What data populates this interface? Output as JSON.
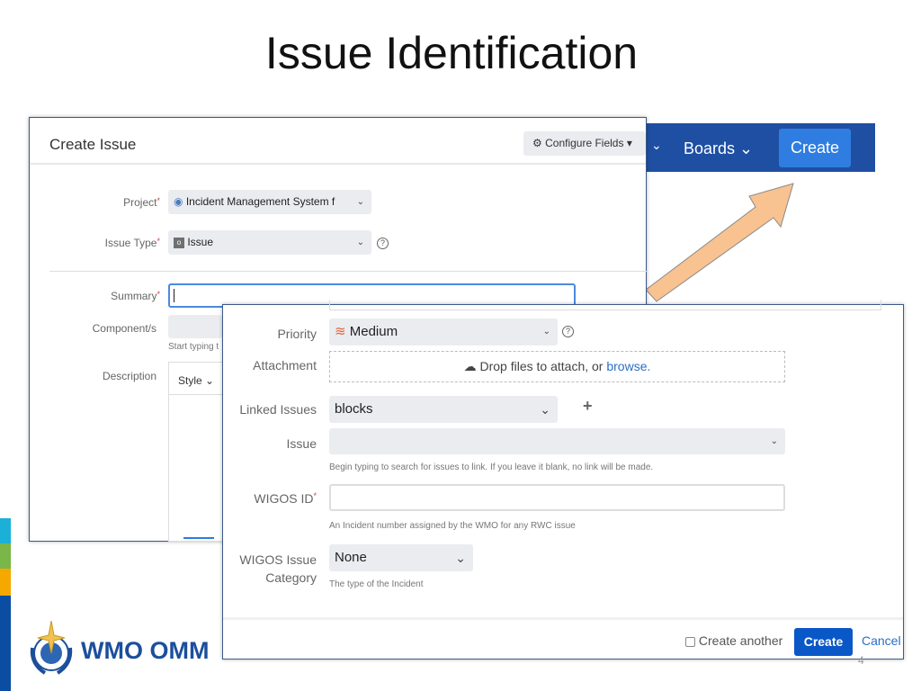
{
  "slide": {
    "title": "Issue Identification",
    "page_number": "4",
    "logo_text": "WMO OMM",
    "strip_colors": [
      "#1ab0d8",
      "#7ab648",
      "#f5a800",
      "#0a4da2"
    ]
  },
  "navbar": {
    "boards_label": "Boards",
    "create_label": "Create",
    "color": "#1e4fa3"
  },
  "dialog_main": {
    "title": "Create Issue",
    "configure_fields": "Configure Fields",
    "project_label": "Project",
    "project_value": "Incident Management System f",
    "issue_type_label": "Issue Type",
    "issue_type_value": "Issue",
    "summary_label": "Summary",
    "summary_value": "",
    "component_label": "Component/s",
    "component_hint": "Start typing t",
    "description_label": "Description",
    "style_label": "Style"
  },
  "dialog_detail": {
    "priority_label": "Priority",
    "priority_value": "Medium",
    "attachment_label": "Attachment",
    "attachment_text": "Drop files to attach, or ",
    "attachment_link": "browse.",
    "linked_issues_label": "Linked Issues",
    "linked_issues_value": "blocks",
    "issue_label": "Issue",
    "issue_value": "",
    "issue_hint": "Begin typing to search for issues to link. If you leave it blank, no link will be made.",
    "wigos_id_label": "WIGOS ID",
    "wigos_id_value": "",
    "wigos_id_hint": "An Incident number assigned by the WMO for any RWC issue",
    "wigos_cat_label_1": "WIGOS Issue",
    "wigos_cat_label_2": "Category",
    "wigos_cat_value": "None",
    "wigos_cat_hint": "The type of the Incident",
    "create_another_label": "Create another",
    "create_another_checked": false,
    "create_button": "Create",
    "cancel_button": "Cancel"
  }
}
